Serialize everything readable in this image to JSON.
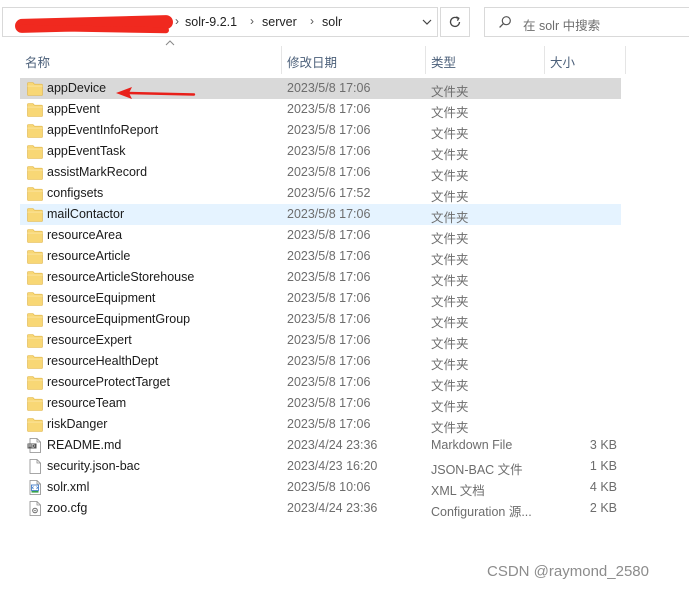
{
  "address_bar": {
    "path_segments": [
      "solr-9.2.1",
      "server",
      "solr"
    ]
  },
  "search": {
    "placeholder": "在 solr 中搜索"
  },
  "columns": {
    "name": "名称",
    "date": "修改日期",
    "type": "类型",
    "size": "大小"
  },
  "files": [
    {
      "name": "appDevice",
      "date": "2023/5/8 17:06",
      "type": "文件夹",
      "size": "",
      "icon": "folder-icon",
      "state": "selected"
    },
    {
      "name": "appEvent",
      "date": "2023/5/8 17:06",
      "type": "文件夹",
      "size": "",
      "icon": "folder-icon",
      "state": ""
    },
    {
      "name": "appEventInfoReport",
      "date": "2023/5/8 17:06",
      "type": "文件夹",
      "size": "",
      "icon": "folder-icon",
      "state": ""
    },
    {
      "name": "appEventTask",
      "date": "2023/5/8 17:06",
      "type": "文件夹",
      "size": "",
      "icon": "folder-icon",
      "state": ""
    },
    {
      "name": "assistMarkRecord",
      "date": "2023/5/8 17:06",
      "type": "文件夹",
      "size": "",
      "icon": "folder-icon",
      "state": ""
    },
    {
      "name": "configsets",
      "date": "2023/5/6 17:52",
      "type": "文件夹",
      "size": "",
      "icon": "folder-icon",
      "state": ""
    },
    {
      "name": "mailContactor",
      "date": "2023/5/8 17:06",
      "type": "文件夹",
      "size": "",
      "icon": "folder-icon",
      "state": "hover"
    },
    {
      "name": "resourceArea",
      "date": "2023/5/8 17:06",
      "type": "文件夹",
      "size": "",
      "icon": "folder-icon",
      "state": ""
    },
    {
      "name": "resourceArticle",
      "date": "2023/5/8 17:06",
      "type": "文件夹",
      "size": "",
      "icon": "folder-icon",
      "state": ""
    },
    {
      "name": "resourceArticleStorehouse",
      "date": "2023/5/8 17:06",
      "type": "文件夹",
      "size": "",
      "icon": "folder-icon",
      "state": ""
    },
    {
      "name": "resourceEquipment",
      "date": "2023/5/8 17:06",
      "type": "文件夹",
      "size": "",
      "icon": "folder-icon",
      "state": ""
    },
    {
      "name": "resourceEquipmentGroup",
      "date": "2023/5/8 17:06",
      "type": "文件夹",
      "size": "",
      "icon": "folder-icon",
      "state": ""
    },
    {
      "name": "resourceExpert",
      "date": "2023/5/8 17:06",
      "type": "文件夹",
      "size": "",
      "icon": "folder-icon",
      "state": ""
    },
    {
      "name": "resourceHealthDept",
      "date": "2023/5/8 17:06",
      "type": "文件夹",
      "size": "",
      "icon": "folder-icon",
      "state": ""
    },
    {
      "name": "resourceProtectTarget",
      "date": "2023/5/8 17:06",
      "type": "文件夹",
      "size": "",
      "icon": "folder-icon",
      "state": ""
    },
    {
      "name": "resourceTeam",
      "date": "2023/5/8 17:06",
      "type": "文件夹",
      "size": "",
      "icon": "folder-icon",
      "state": ""
    },
    {
      "name": "riskDanger",
      "date": "2023/5/8 17:06",
      "type": "文件夹",
      "size": "",
      "icon": "folder-icon",
      "state": ""
    },
    {
      "name": "README.md",
      "date": "2023/4/24 23:36",
      "type": "Markdown File",
      "size": "3 KB",
      "icon": "markdown-file-icon",
      "state": ""
    },
    {
      "name": "security.json-bac",
      "date": "2023/4/23 16:20",
      "type": "JSON-BAC 文件",
      "size": "1 KB",
      "icon": "blank-file-icon",
      "state": ""
    },
    {
      "name": "solr.xml",
      "date": "2023/5/8 10:06",
      "type": "XML 文档",
      "size": "4 KB",
      "icon": "xml-file-icon",
      "state": ""
    },
    {
      "name": "zoo.cfg",
      "date": "2023/4/24 23:36",
      "type": "Configuration 源...",
      "size": "2 KB",
      "icon": "config-file-icon",
      "state": ""
    }
  ],
  "watermark": "CSDN @raymond_2580",
  "colors": {
    "selected_row": "#d9d9d9",
    "hover_row": "#e5f3ff",
    "folder": "#f8d775",
    "arrow": "#e8201a",
    "header_text": "#4c607a"
  }
}
